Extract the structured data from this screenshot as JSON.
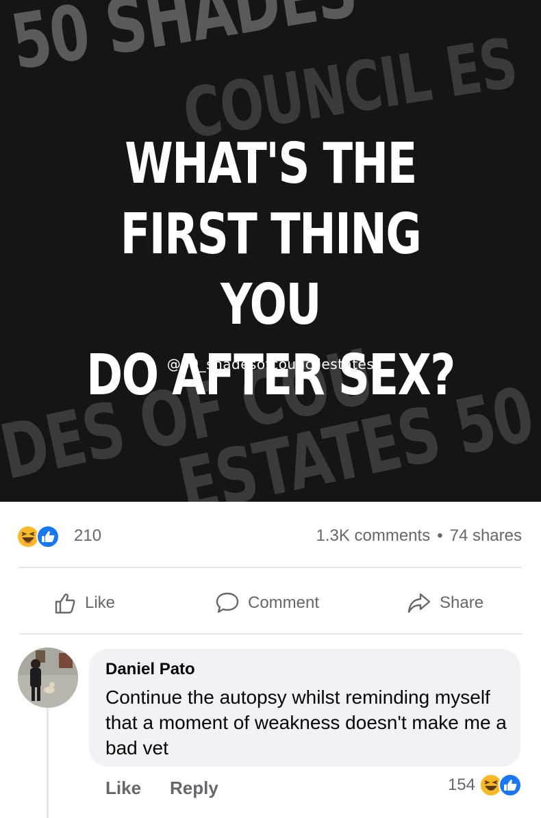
{
  "post": {
    "headline_lines": [
      "WHAT'S THE",
      "FIRST THING YOU",
      "DO AFTER SEX?"
    ],
    "handle": "@50_shadesofcouncilestates",
    "background_words": [
      "50 SHADES",
      "COUNCIL ES",
      "DES OF COU",
      "ESTATES 50"
    ]
  },
  "stats": {
    "reaction_count": "210",
    "comments": "1.3K comments",
    "separator": "•",
    "shares": "74 shares"
  },
  "actions": {
    "like": "Like",
    "comment": "Comment",
    "share": "Share"
  },
  "comment": {
    "author": "Daniel Pato",
    "text": "Continue the autopsy whilst reminding myself that a moment of weakness doesn't make me a bad vet",
    "like_label": "Like",
    "reply_label": "Reply",
    "reaction_count": "154"
  },
  "colors": {
    "facebook_blue": "#1877f2",
    "haha_yellow": "#f7b928",
    "secondary_text": "#65676b",
    "bubble_bg": "#f0f2f5"
  },
  "icons": [
    "haha-reaction-icon",
    "like-reaction-icon",
    "thumbs-up-icon",
    "comment-bubble-icon",
    "share-arrow-icon"
  ]
}
